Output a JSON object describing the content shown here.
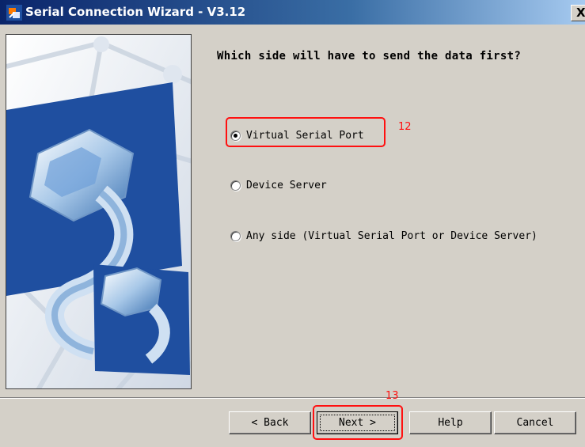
{
  "window": {
    "title": "Serial Connection Wizard - V3.12",
    "close_label": "X"
  },
  "question": "Which side will have to send the data first?",
  "options": [
    {
      "label": "Virtual Serial Port",
      "selected": true
    },
    {
      "label": "Device Server",
      "selected": false
    },
    {
      "label": "Any side (Virtual Serial Port or Device Server)",
      "selected": false
    }
  ],
  "annotations": {
    "option_marker": "12",
    "next_marker": "13",
    "color": "#ff1010"
  },
  "buttons": {
    "back": "< Back",
    "next": "Next >",
    "help": "Help",
    "cancel": "Cancel"
  },
  "colors": {
    "title_bar": "#0a246a",
    "dialog_bg": "#d4d0c8",
    "art_blue": "#1f4fa0"
  },
  "icons": {
    "title": "plug-icon",
    "side_art": "serial-cable-illustration"
  }
}
